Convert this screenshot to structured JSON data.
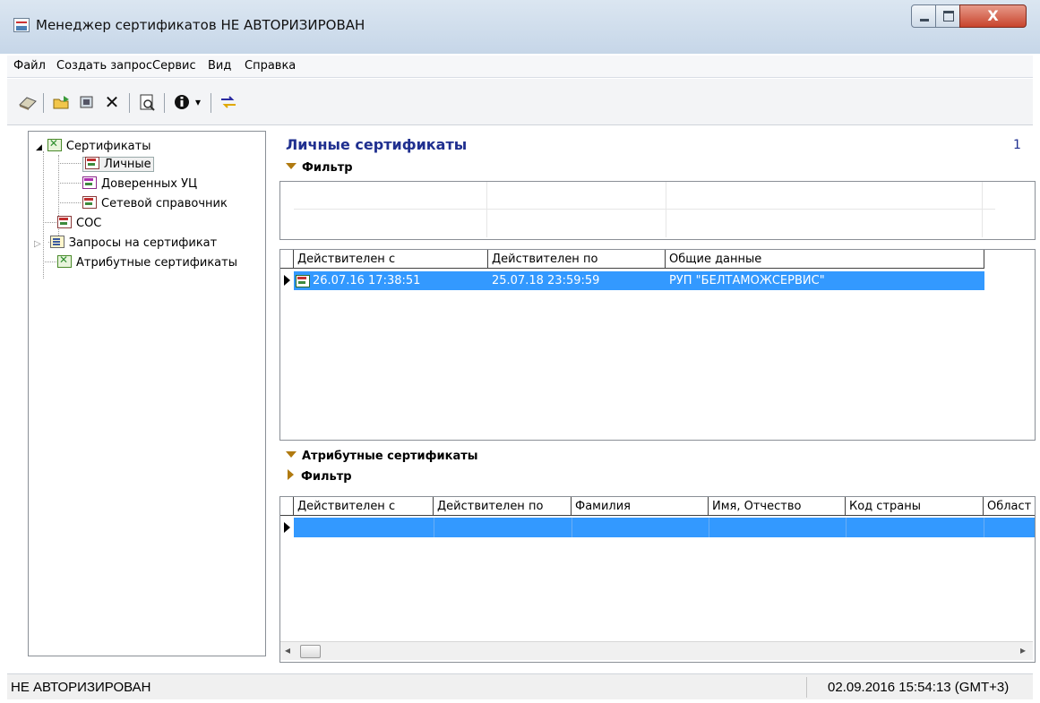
{
  "window": {
    "title": "Менеджер сертификатов  НЕ АВТОРИЗИРОВАН",
    "close_glyph": "X"
  },
  "menu": {
    "items": [
      "Файл",
      "Создать запрос",
      "Сервис",
      "Вид",
      "Справка"
    ]
  },
  "toolbar": {
    "icons": [
      "book-icon",
      "open-folder-icon",
      "import-export-icon",
      "delete-icon",
      "preview-icon",
      "info-icon",
      "dropdown-arrow-icon",
      "refresh-swap-icon"
    ],
    "info_glyph": "❶",
    "delete_glyph": "✕",
    "refresh_glyph": "⇄",
    "dropdown_glyph": "▾"
  },
  "tree": {
    "nodes": [
      {
        "label": "Сертификаты"
      },
      {
        "label": "Личные"
      },
      {
        "label": "Доверенных УЦ"
      },
      {
        "label": "Сетевой справочник"
      },
      {
        "label": "СОС"
      },
      {
        "label": "Запросы на сертификат"
      },
      {
        "label": "Атрибутные сертификаты"
      }
    ],
    "expanded_glyph": "◢",
    "collapsed_glyph": "▷"
  },
  "main": {
    "title": "Личные сертификаты",
    "count": "1",
    "filter_label": "Фильтр",
    "personal_table": {
      "columns": [
        "Действителен с",
        "Действителен по",
        "Общие данные"
      ],
      "rows": [
        {
          "valid_from": "26.07.16 17:38:51",
          "valid_to": "25.07.18 23:59:59",
          "subject": "РУП \"БЕЛТАМОЖСЕРВИС\""
        }
      ]
    },
    "attr_section_title": "Атрибутные сертификаты",
    "attr_filter_label": "Фильтр",
    "attr_table": {
      "columns": [
        "Действителен с",
        "Действителен по",
        "Фамилия",
        "Имя, Отчество",
        "Код страны",
        "Област"
      ]
    },
    "scroll_left_glyph": "◂",
    "scroll_right_glyph": "▸"
  },
  "status": {
    "left": "НЕ АВТОРИЗИРОВАН",
    "datetime": "02.09.2016 15:54:13 (GMT+3)"
  },
  "colors": {
    "selection": "#3399ff",
    "title_blue": "#1f2f8f"
  }
}
